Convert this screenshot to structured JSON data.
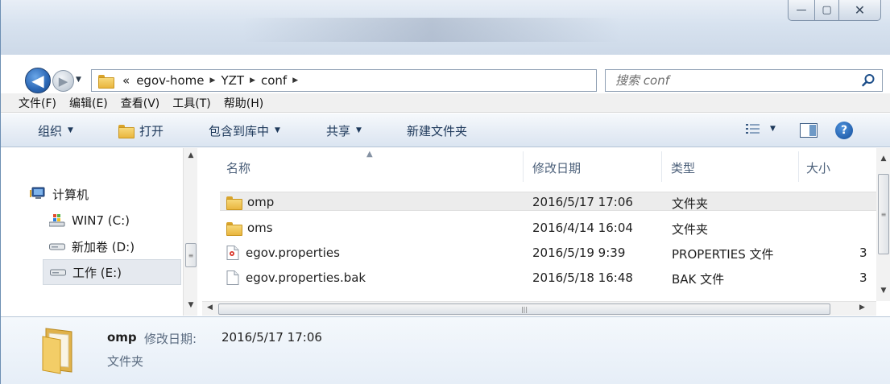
{
  "window": {
    "caption": {
      "minimize": "—",
      "maximize": "▢",
      "close": "✕"
    }
  },
  "nav": {
    "back_glyph": "◀",
    "forward_glyph": "▶",
    "breadcrumb_prefix": "«",
    "breadcrumb": [
      "egov-home",
      "YZT",
      "conf"
    ],
    "separator": "▶",
    "search_placeholder": "搜索 conf"
  },
  "menu": [
    "文件(F)",
    "编辑(E)",
    "查看(V)",
    "工具(T)",
    "帮助(H)"
  ],
  "commands": {
    "organize": "组织",
    "open": "打开",
    "include": "包含到库中",
    "share": "共享",
    "new_folder": "新建文件夹",
    "help": "?"
  },
  "tree": {
    "computer": "计算机",
    "drives": [
      "WIN7 (C:)",
      "新加卷 (D:)",
      "工作 (E:)"
    ],
    "selected": "工作 (E:)"
  },
  "file_list": {
    "columns": [
      "名称",
      "修改日期",
      "类型",
      "大小"
    ],
    "rows": [
      {
        "name": "omp",
        "date": "2016/5/17 17:06",
        "type": "文件夹",
        "size": "",
        "icon": "folder-icon",
        "selected": true
      },
      {
        "name": "oms",
        "date": "2016/4/14 16:04",
        "type": "文件夹",
        "size": "",
        "icon": "folder-icon",
        "selected": false
      },
      {
        "name": "egov.properties",
        "date": "2016/5/19 9:39",
        "type": "PROPERTIES 文件",
        "size": "3",
        "icon": "properties-file-icon",
        "selected": false
      },
      {
        "name": "egov.properties.bak",
        "date": "2016/5/18 16:48",
        "type": "BAK 文件",
        "size": "3",
        "icon": "blank-file-icon",
        "selected": false
      }
    ]
  },
  "details": {
    "name": "omp",
    "date_label": "修改日期:",
    "date_value": "2016/5/17 17:06",
    "type": "文件夹"
  },
  "colors": {
    "accent": "#1e6ab8",
    "selection": "#ececec",
    "command_text": "#1e395b"
  }
}
